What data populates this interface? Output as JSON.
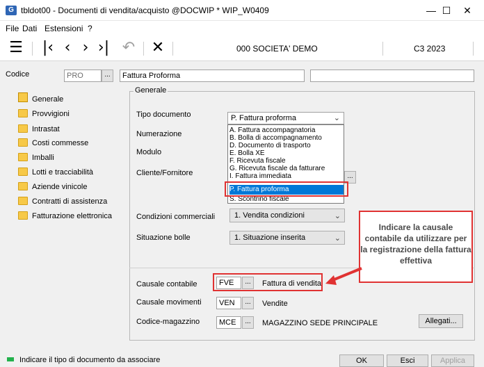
{
  "window": {
    "app_icon_letter": "G",
    "title": "tbldot00 - Documenti di vendita/acquisto @DOCWIP * WIP_W0409",
    "minimize": "—",
    "maximize": "☐",
    "close": "✕"
  },
  "menu": [
    "File",
    "Dati",
    "Estensioni",
    "?"
  ],
  "toolbar": {
    "menu_glyph": "☰",
    "first_glyph": "|‹",
    "prev_glyph": "‹",
    "next_glyph": "›",
    "last_glyph": "›|",
    "undo_glyph": "↶",
    "cancel_glyph": "✕",
    "company": "000 SOCIETA' DEMO",
    "year": "C3 2023"
  },
  "code": {
    "label": "Codice",
    "value": "PRO",
    "lookup": "...",
    "description": "Fattura Proforma",
    "extra": ""
  },
  "sidebar": {
    "items": [
      {
        "label": "Generale",
        "selected": true
      },
      {
        "label": "Provvigioni"
      },
      {
        "label": "Intrastat"
      },
      {
        "label": "Costi commesse"
      },
      {
        "label": "Imballi"
      },
      {
        "label": "Lotti e tracciabilità"
      },
      {
        "label": "Aziende vinicole"
      },
      {
        "label": "Contratti di assistenza"
      },
      {
        "label": "Fatturazione elettronica"
      }
    ]
  },
  "general": {
    "legend": "Generale",
    "tipo_documento_label": "Tipo documento",
    "tipo_documento_value": "P. Fattura proforma",
    "numerazione_label": "Numerazione",
    "modulo_label": "Modulo",
    "cliente_label": "Cliente/Fornitore",
    "cliente_lookup": "...",
    "condizioni_label": "Condizioni commerciali",
    "condizioni_value": "1. Vendita condizioni",
    "situazione_label": "Situazione bolle",
    "situazione_value": "1. Situazione inserita",
    "dropdown_options": [
      "A. Fattura accompagnatoria",
      "B. Bolla di accompagnamento",
      "D. Documento di trasporto",
      "E. Bolla XE",
      "F. Ricevuta fiscale",
      "G. Ricevuta fiscale da fatturare",
      "I. Fattura immediata",
      "P. Fattura proforma",
      "S. Scontrino fiscale"
    ],
    "dropdown_selected_index": 7,
    "causale_contabile_label": "Causale contabile",
    "causale_contabile_code": "FVE",
    "causale_contabile_lookup": "...",
    "causale_contabile_desc": "Fattura di vendita",
    "causale_mov_label": "Causale movimenti",
    "causale_mov_code": "VEN",
    "causale_mov_lookup": "...",
    "causale_mov_desc": "Vendite",
    "magazzino_label": "Codice-magazzino",
    "magazzino_code": "MCE",
    "magazzino_lookup": "...",
    "magazzino_desc": "MAGAZZINO SEDE PRINCIPALE",
    "allegati": "Allegati..."
  },
  "callout": {
    "text": "Indicare la causale contabile da utilizzare per la registrazione della fattura effettiva"
  },
  "status": {
    "text": "Indicare il tipo di documento da associare",
    "indicator_color": "#22b14c"
  },
  "buttons": {
    "ok": "OK",
    "esci": "Esci",
    "applica": "Applica"
  },
  "colors": {
    "accent": "#0078d7",
    "highlight": "#e03232"
  }
}
